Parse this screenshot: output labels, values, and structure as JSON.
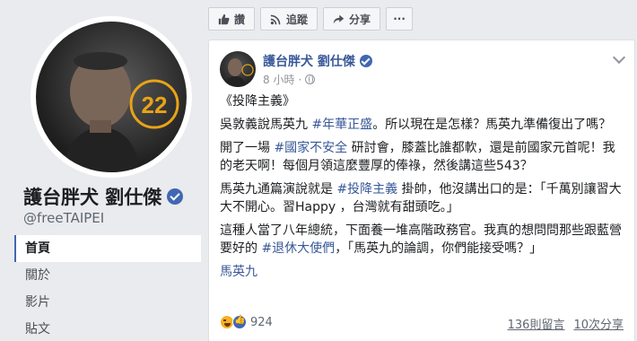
{
  "profile": {
    "name": "護台胖犬 劉仕傑",
    "handle": "@freeTAIPEI",
    "avatar_badge": "22"
  },
  "left_nav": [
    {
      "label": "首頁",
      "active": true
    },
    {
      "label": "關於",
      "active": false
    },
    {
      "label": "影片",
      "active": false
    },
    {
      "label": "貼文",
      "active": false
    }
  ],
  "action_bar": {
    "like_label": "讚",
    "follow_label": "追蹤",
    "share_label": "分享",
    "more_label": "···"
  },
  "post": {
    "author": "護台胖犬 劉仕傑",
    "time": "8 小時",
    "title": "《投降主義》",
    "p1_a": "吳敦義說馬英九 ",
    "p1_tag": "#年華正盛",
    "p1_b": "。所以現在是怎樣？馬英九準備復出了嗎？",
    "p2_a": "開了一場 ",
    "p2_tag": "#國家不安全",
    "p2_b": " 研討會，膝蓋比誰都軟，還是前國家元首呢！我的老天啊！每個月領這麼豐厚的俸祿，然後講這些543？",
    "p3_a": "馬英九通篇演說就是 ",
    "p3_tag": "#投降主義",
    "p3_b": " 掛帥，他沒講出口的是：「千萬別讓習大大不開心。習Happy ，台灣就有甜頭吃。」",
    "p4_a": "這種人當了八年總統，下面養一堆高階政務官。我真的想問問那些跟藍營要好的 ",
    "p4_tag": "#退休大使們",
    "p4_b": "，「馬英九的論調，你們能接受嗎？」",
    "p5_link": "馬英九",
    "reaction_count": "924",
    "comments": "136則留言",
    "shares": "10次分享"
  },
  "colors": {
    "link": "#385898",
    "brand": "#4267b2",
    "badge": "#e8a317"
  }
}
